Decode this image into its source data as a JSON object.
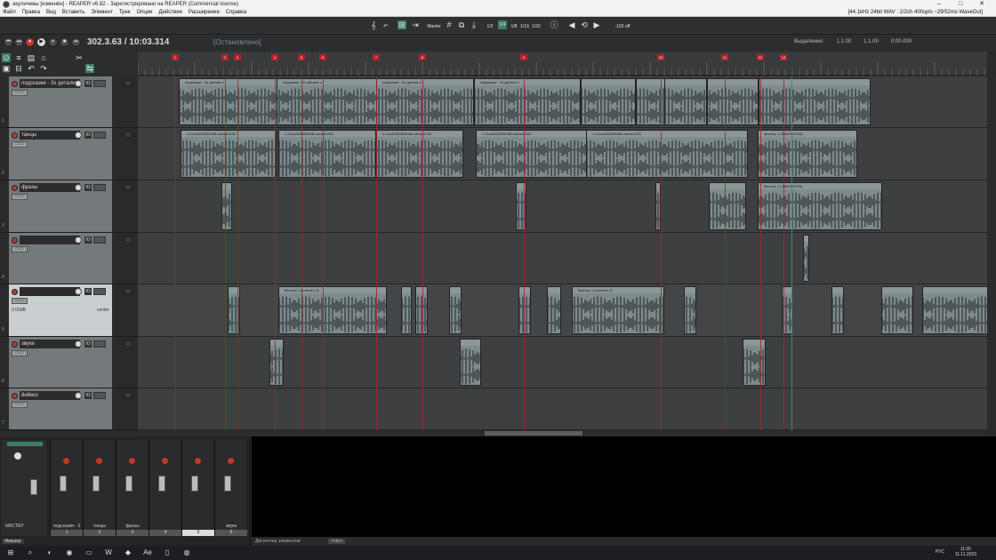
{
  "window": {
    "title": "акуличевы [изменён] - REAPER v6.82 - Зарегистрировано на REAPER (Commercial license)",
    "controls": [
      "–",
      "□",
      "✕"
    ]
  },
  "menu": {
    "items": [
      "Файл",
      "Правка",
      "Вид",
      "Вставить",
      "Элемент",
      "Трек",
      "Опции",
      "Действия",
      "Расширения",
      "Справка"
    ],
    "info": "[44.1kHz 24bit WAV : 2/2ch 400spls ~29/52ms WaveOut]"
  },
  "toolbar": {
    "grid_label": "Master",
    "counters": [
      "1/2",
      "1/4",
      "1/8",
      "1/16",
      "1/32"
    ],
    "right_text": "-102 off"
  },
  "transport": {
    "position": "302.3.63",
    "length": "10:03.314",
    "separator": " / ",
    "state": "[Остановлено]"
  },
  "selection": {
    "label": "Выделение:",
    "start": "1.1.00",
    "end": "1.1.00",
    "length": "0:00.000"
  },
  "tracks": [
    {
      "num": "1",
      "name": "подсказки - 3х детали и",
      "selected": false
    },
    {
      "num": "2",
      "name": "танцы",
      "selected": false
    },
    {
      "num": "3",
      "name": "фразы",
      "selected": false
    },
    {
      "num": "4",
      "name": "",
      "selected": false
    },
    {
      "num": "5",
      "name": "",
      "selected": true,
      "vol": "0.00dB",
      "right": "center"
    },
    {
      "num": "6",
      "name": "звуки",
      "selected": false
    },
    {
      "num": "7",
      "name": "8н6вос",
      "selected": false
    }
  ],
  "markers": [
    "1",
    "2",
    "3",
    "4",
    "5",
    "6",
    "7",
    "8",
    "9",
    "10",
    "11",
    "12",
    "13"
  ],
  "items_header_labels": {
    "track1": "подсказки - 3х детали и",
    "track2": "1-21nA43Z35904B-s4nae1235",
    "track3": "Мастер 1 (4989620765)",
    "track5": "Мастер 1 (считать 2)"
  },
  "mixer": {
    "master_label": "МАСТЕР",
    "strips": [
      {
        "name": "подсказки - 3",
        "num": "1"
      },
      {
        "name": "танцы",
        "num": "2"
      },
      {
        "name": "фразы",
        "num": "3"
      },
      {
        "name": "",
        "num": "4"
      },
      {
        "name": "",
        "num": "5",
        "selected": true
      },
      {
        "name": "звуки",
        "num": "6"
      }
    ],
    "tab": "Микшер"
  },
  "dock_tabs": [
    "Видео",
    "Диспетчер элементов",
    "Video"
  ],
  "taskbar": {
    "lang": "РУС",
    "time": "11:00",
    "date": "11.11.2023"
  }
}
